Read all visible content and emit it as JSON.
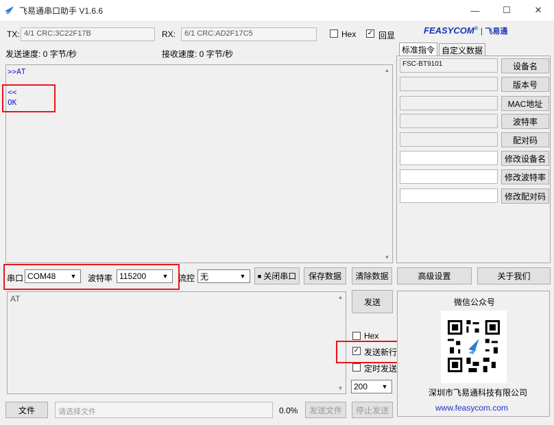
{
  "window": {
    "title": "飞易通串口助手 V1.6.6",
    "min": "—",
    "max": "☐",
    "close": "✕"
  },
  "stats": {
    "tx_label": "TX:",
    "tx_value": "4/1 CRC:3C22F17B",
    "rx_label": "RX:",
    "rx_value": "6/1 CRC:AD2F17C5",
    "hex_label": "Hex",
    "echo_label": "回显",
    "echo_check": "✓",
    "send_speed": "发送速度: 0 字节/秒",
    "recv_speed": "接收速度: 0 字节/秒"
  },
  "brand": {
    "logo": "FEASYCOM",
    "logo_mark": "®",
    "logo_cn": "飞易通",
    "logo_color": "#1a35b5"
  },
  "receive": {
    "line1": ">>AT",
    "line2": "<<",
    "line3": "OK"
  },
  "port_bar": {
    "port_label": "串口",
    "port_value": "COM48",
    "baud_label": "波特率",
    "baud_value": "115200",
    "flow_label": "流控",
    "flow_value": "无",
    "close_port": "关闭串口",
    "close_port_dot": "■",
    "save_data": "保存数据",
    "clear_data": "清除数据"
  },
  "send": {
    "text": "AT",
    "send_button": "发送",
    "hex_label": "Hex",
    "newline_label": "发送新行",
    "newline_check": "✓",
    "timer_label": "定时发送",
    "interval_value": "200"
  },
  "bottom": {
    "file_button": "文件",
    "file_placeholder": "请选择文件",
    "progress": "0.0%",
    "send_file": "发送文件",
    "stop_send": "停止发送"
  },
  "right": {
    "tabs": [
      "标准指令",
      "自定义数据"
    ],
    "fields": [
      "FSC-BT9101",
      "",
      "",
      "",
      "",
      "",
      "",
      ""
    ],
    "buttons": [
      "设备名",
      "版本号",
      "MAC地址",
      "波特率",
      "配对码",
      "修改设备名",
      "修改波特率",
      "修改配对码"
    ],
    "advanced": "高级设置",
    "about": "关于我们",
    "wechat_title": "微信公众号",
    "company": "深圳市飞易通科技有限公司",
    "website": "www.feasycom.com",
    "link_color": "#1a35c8"
  },
  "colors": {
    "highlight_red": "#e8141c",
    "recv_text": "#1a1ad0"
  }
}
